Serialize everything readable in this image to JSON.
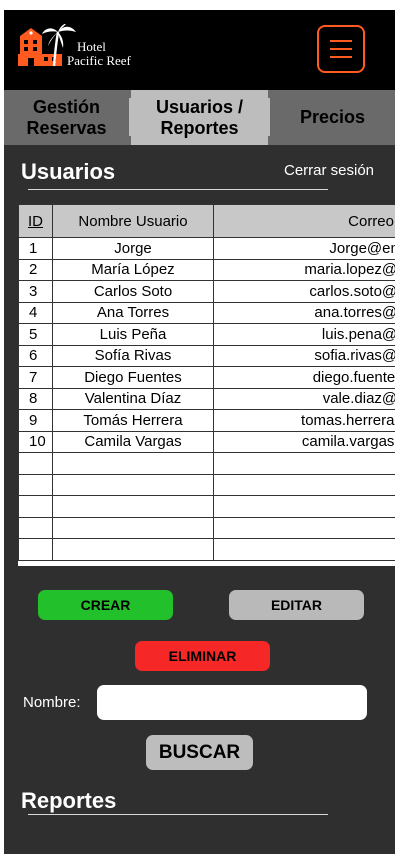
{
  "header": {
    "brand_line1": "Hotel",
    "brand_line2": "Pacific Reef",
    "menu_icon": "hamburger-menu-icon",
    "accent": "#ff5a1f"
  },
  "tabs": [
    {
      "label": "Gestión\nReservas",
      "active": false
    },
    {
      "label": "Usuarios /\nReportes",
      "active": true
    },
    {
      "label": "Precios",
      "active": false
    }
  ],
  "users_section": {
    "title": "Usuarios",
    "logout_label": "Cerrar sesión"
  },
  "table": {
    "columns": [
      "ID",
      "Nombre Usuario",
      "Correo"
    ],
    "rows": [
      {
        "id": "1",
        "name": "Jorge",
        "email": "Jorge@email"
      },
      {
        "id": "2",
        "name": "María López",
        "email": "maria.lopez@em"
      },
      {
        "id": "3",
        "name": "Carlos Soto",
        "email": "carlos.soto@em"
      },
      {
        "id": "4",
        "name": "Ana Torres",
        "email": "ana.torres@em"
      },
      {
        "id": "5",
        "name": "Luis Peña",
        "email": "luis.pena@em"
      },
      {
        "id": "6",
        "name": "Sofía Rivas",
        "email": "sofia.rivas@em"
      },
      {
        "id": "7",
        "name": "Diego Fuentes",
        "email": "diego.fuentes@"
      },
      {
        "id": "8",
        "name": "Valentina Díaz",
        "email": "vale.diaz@em"
      },
      {
        "id": "9",
        "name": "Tomás Herrera",
        "email": "tomas.herrera@e"
      },
      {
        "id": "10",
        "name": "Camila Vargas",
        "email": "camila.vargas@e"
      },
      {
        "id": "",
        "name": "",
        "email": ""
      },
      {
        "id": "",
        "name": "",
        "email": ""
      },
      {
        "id": "",
        "name": "",
        "email": ""
      },
      {
        "id": "",
        "name": "",
        "email": ""
      },
      {
        "id": "",
        "name": "",
        "email": ""
      }
    ]
  },
  "actions": {
    "create_label": "CREAR",
    "edit_label": "EDITAR",
    "delete_label": "ELIMINAR",
    "create_color": "#22c02a",
    "edit_color": "#b9b9b9",
    "delete_color": "#f52727"
  },
  "search": {
    "label": "Nombre:",
    "value": "",
    "button_label": "BUSCAR"
  },
  "reports_section": {
    "title": "Reportes"
  }
}
